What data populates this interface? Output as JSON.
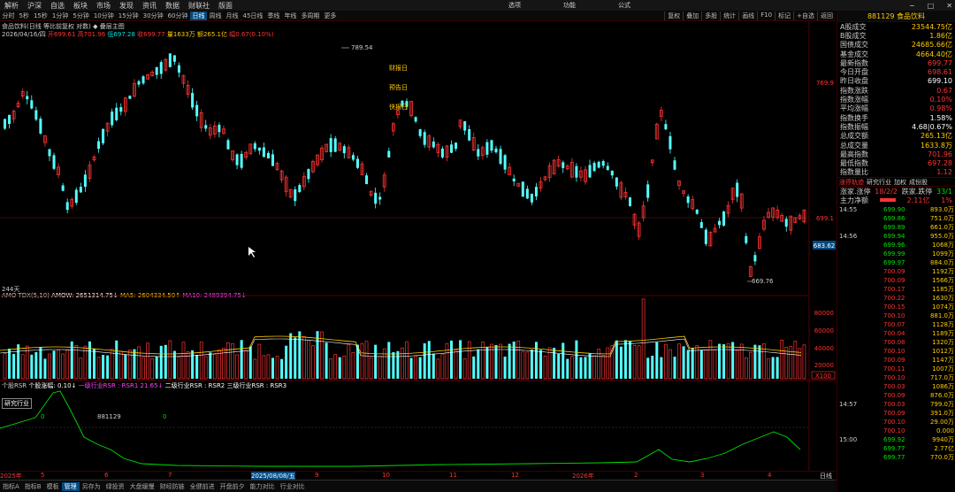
{
  "menubar": {
    "items": [
      "解析",
      "沪深",
      "自选",
      "板块",
      "市场",
      "发现",
      "资讯",
      "数据",
      "财联社",
      "版面"
    ],
    "center": [
      "选项",
      "功能",
      "公式"
    ],
    "window_buttons": [
      "−",
      "□",
      "✕"
    ]
  },
  "toolbar": {
    "periods": [
      "分时",
      "5秒",
      "15秒",
      "1分钟",
      "5分钟",
      "10分钟",
      "15分钟",
      "30分钟",
      "60分钟",
      "日线",
      "周线",
      "月线",
      "45日线",
      "季线",
      "年线",
      "多周期",
      "更多"
    ],
    "active_period": "日线",
    "tools": [
      "复权",
      "叠加",
      "多股",
      "统计",
      "画线",
      "F10",
      "标记",
      "+自选",
      "返回"
    ]
  },
  "chart": {
    "title": "食品饮料(日线 等比前复权 对数)",
    "extra": "◆ 叠层主图",
    "info_date": "2026/04/16/四",
    "open_label": "开699.61",
    "high_label": "高701.96",
    "low_label": "低697.28",
    "close_label": "收699.77",
    "vol_label": "量1633万",
    "amount_label": "额265.1亿",
    "change_label": "幅0.67(0.10%)",
    "price_high": "789.54",
    "price_low": "669.76",
    "axis_labels": [
      "769.9",
      "699.1"
    ],
    "cursor_price": "683.62",
    "annotations": [
      "财报日",
      "预告日",
      "快报日"
    ],
    "days_label": "244天",
    "amo": {
      "title": "AMO-TDX(5,10)",
      "amow": "AMOW: 2651314.75↓",
      "ma5": "MA5: 2604334.50↑",
      "ma10": "MA10: 2489394.75↓",
      "axis": [
        "80000",
        "60000",
        "40000",
        "20000"
      ],
      "unit": "X100"
    },
    "rsr": {
      "title": "个股RSR",
      "label1": "个股涨幅: 0.10↓",
      "label2": "一级行业RSR : RSR1 21.65↓",
      "label3": "二级行业RSR : RSR2",
      "label4": "三级行业RSR : RSR3",
      "box_label": "研究行业",
      "code": "881129",
      "v0a": "0",
      "v0b": "0"
    }
  },
  "datebar": {
    "labels": [
      "2025年",
      "5",
      "6",
      "7",
      "2025/08/08/五",
      "9",
      "10",
      "11",
      "12",
      "2026年",
      "2",
      "3",
      "4"
    ],
    "right_label": "日线"
  },
  "tabs": {
    "row1": [
      "指标A",
      "指标B",
      "模板",
      "管理",
      "另存为",
      "绿投资",
      "大盘缓慢",
      "财经防链",
      "全健前进",
      "开盘前夕",
      "能力对比",
      "行业对比"
    ],
    "active": "管理"
  },
  "panel": {
    "code_name": "881129 食品饮料",
    "stats": [
      {
        "k": "A股成交",
        "v": "23544.75亿",
        "c": "#ffcc00"
      },
      {
        "k": "B股成交",
        "v": "1.86亿",
        "c": "#ffcc00"
      },
      {
        "k": "国债成交",
        "v": "24685.66亿",
        "c": "#ffcc00"
      },
      {
        "k": "基金成交",
        "v": "4664.40亿",
        "c": "#ffcc00"
      },
      {
        "k": "最新指数",
        "v": "699.77",
        "c": "#ff3333"
      },
      {
        "k": "今日开盘",
        "v": "698.61",
        "c": "#ff3333"
      },
      {
        "k": "昨日收盘",
        "v": "699.10",
        "c": "#ffffff"
      },
      {
        "k": "指数涨跌",
        "v": "0.67",
        "c": "#ff3333"
      },
      {
        "k": "指数涨幅",
        "v": "0.10%",
        "c": "#ff3333"
      },
      {
        "k": "平均涨幅",
        "v": "0.98%",
        "c": "#ff3333"
      },
      {
        "k": "指数换手",
        "v": "1.58%",
        "c": "#ffffff"
      },
      {
        "k": "指数振幅",
        "v": "4.68|0.67%",
        "c": "#ffffff"
      },
      {
        "k": "总成交额",
        "v": "265.13亿",
        "c": "#ffcc00"
      },
      {
        "k": "总成交量",
        "v": "1633.8万",
        "c": "#ffcc00"
      },
      {
        "k": "最高指数",
        "v": "701.96",
        "c": "#ff3333"
      },
      {
        "k": "最低指数",
        "v": "697.28",
        "c": "#ff3333"
      },
      {
        "k": "指数量比",
        "v": "1.12",
        "c": "#ff3333"
      }
    ],
    "tabrow": [
      "涨停轨迹",
      "研究行业",
      "加权",
      "成份股"
    ],
    "rise_fall": {
      "k1": "涨家.涨停",
      "v1": "18/2/2",
      "k2": "跌家.跌停",
      "v2": "33/1"
    },
    "mainflow": {
      "k": "主力净额",
      "v": "2.11亿",
      "v2": "1%"
    },
    "ticks": [
      {
        "t": "14:55",
        "p": "699.90",
        "v": "893.0万"
      },
      {
        "t": "",
        "p": "699.86",
        "v": "751.0万"
      },
      {
        "t": "",
        "p": "699.89",
        "v": "661.0万"
      },
      {
        "t": "14:56",
        "p": "699.94",
        "v": "955.0万"
      },
      {
        "t": "",
        "p": "699.96",
        "v": "1068万"
      },
      {
        "t": "",
        "p": "699.99",
        "v": "1099万"
      },
      {
        "t": "",
        "p": "699.97",
        "v": "884.0万"
      },
      {
        "t": "",
        "p": "700.09",
        "v": "1192万"
      },
      {
        "t": "",
        "p": "700.09",
        "v": "1566万"
      },
      {
        "t": "",
        "p": "700.17",
        "v": "1185万"
      },
      {
        "t": "",
        "p": "700.22",
        "v": "1630万"
      },
      {
        "t": "",
        "p": "700.15",
        "v": "1074万"
      },
      {
        "t": "",
        "p": "700.10",
        "v": "881.0万"
      },
      {
        "t": "",
        "p": "700.07",
        "v": "1128万"
      },
      {
        "t": "",
        "p": "700.04",
        "v": "1189万"
      },
      {
        "t": "",
        "p": "700.08",
        "v": "1320万"
      },
      {
        "t": "",
        "p": "700.10",
        "v": "1012万"
      },
      {
        "t": "",
        "p": "700.09",
        "v": "1147万"
      },
      {
        "t": "",
        "p": "700.11",
        "v": "1007万"
      },
      {
        "t": "",
        "p": "700.10",
        "v": "717.0万"
      },
      {
        "t": "",
        "p": "700.03",
        "v": "1086万"
      },
      {
        "t": "",
        "p": "700.09",
        "v": "876.0万"
      },
      {
        "t": "14:57",
        "p": "700.03",
        "v": "799.0万"
      },
      {
        "t": "",
        "p": "700.09",
        "v": "391.0万"
      },
      {
        "t": "",
        "p": "700.10",
        "v": "29.00万"
      },
      {
        "t": "",
        "p": "700.10",
        "v": "0.000"
      },
      {
        "t": "15:00",
        "p": "699.92",
        "v": "9940万"
      },
      {
        "t": "",
        "p": "699.77",
        "v": "2.77亿"
      },
      {
        "t": "",
        "p": "699.77",
        "v": "770.0万"
      }
    ]
  }
}
